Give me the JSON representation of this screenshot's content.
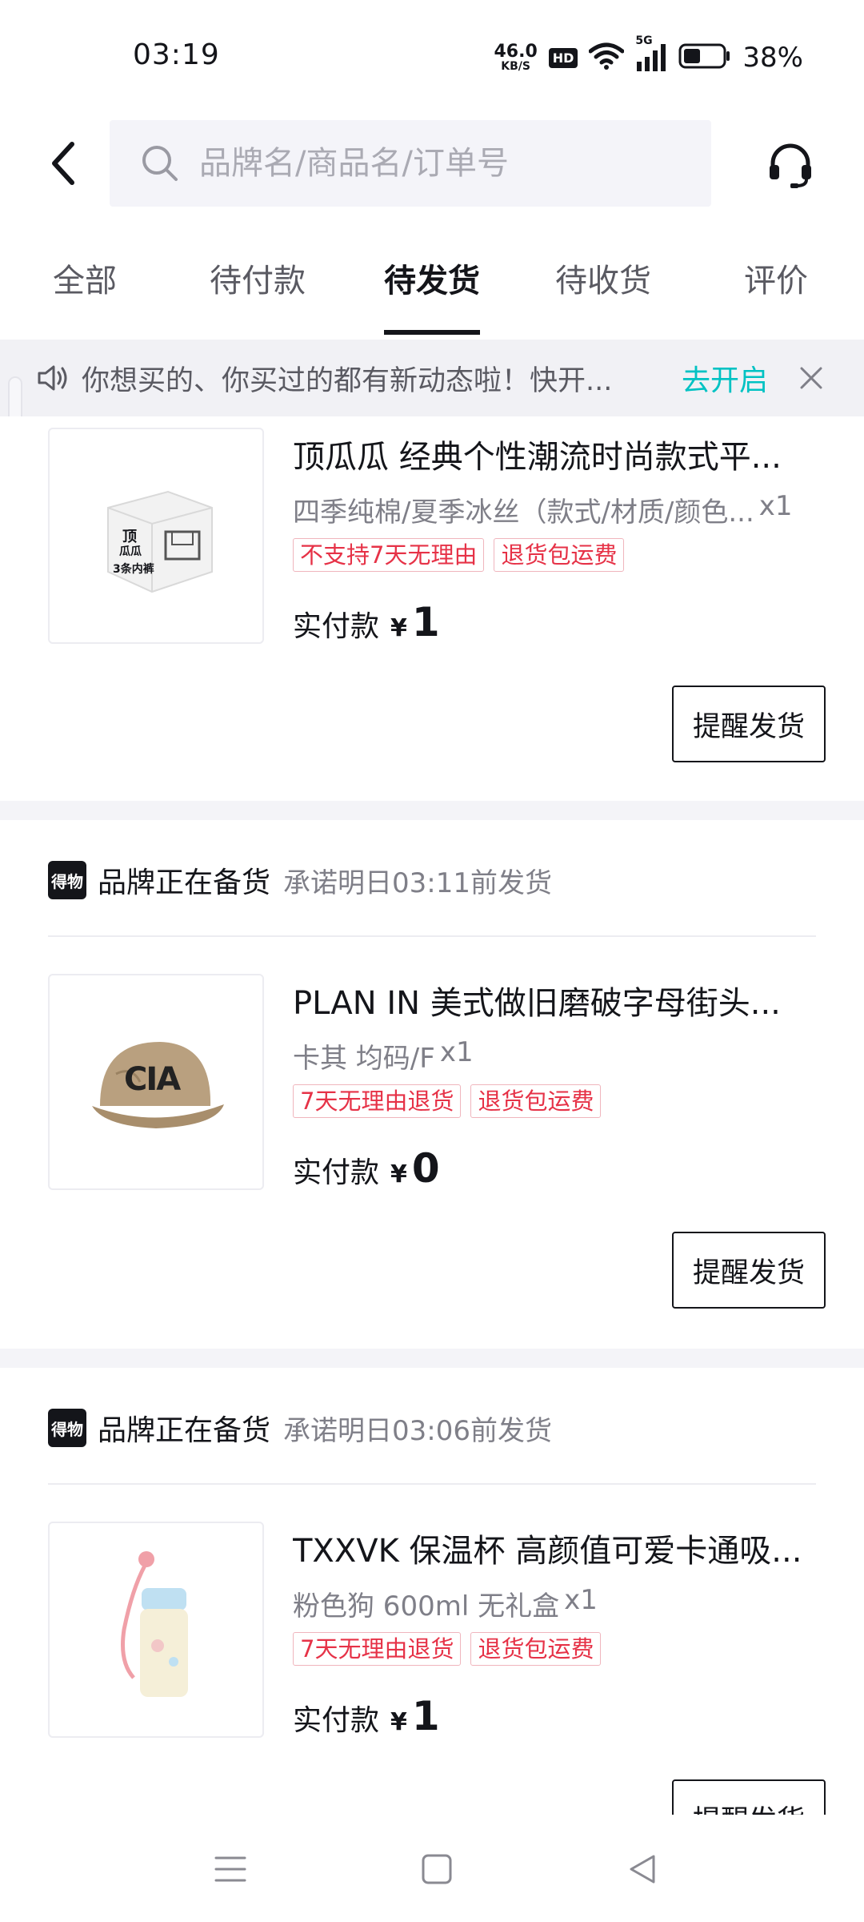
{
  "status_bar": {
    "time": "03:19",
    "net_speed_value": "46.0",
    "net_speed_unit": "KB/S",
    "hd": "HD",
    "signal_type": "5G",
    "battery": "38%"
  },
  "header": {
    "search_placeholder": "品牌名/商品名/订单号"
  },
  "tabs": [
    {
      "label": "全部"
    },
    {
      "label": "待付款"
    },
    {
      "label": "待发货"
    },
    {
      "label": "待收货"
    },
    {
      "label": "评价"
    }
  ],
  "active_tab": "待发货",
  "notice": {
    "text": "你想买的、你买过的都有新动态啦！快开...",
    "action": "去开启"
  },
  "orders": [
    {
      "title": "顶瓜瓜 经典个性潮流时尚款式平...",
      "spec": "四季纯棉/夏季冰丝（款式/材质/颜色...",
      "qty": "x1",
      "tags": [
        "不支持7天无理由",
        "退货包运费"
      ],
      "pay_label": "实付款",
      "currency": "¥",
      "amount": "1",
      "button": "提醒发货",
      "thumb_text": [
        "顶",
        "瓜瓜",
        "3条内裤"
      ]
    },
    {
      "brand_logo": "得物",
      "status": "品牌正在备货",
      "promise": "承诺明日03:11前发货",
      "title": "PLAN IN 美式做旧磨破字母街头...",
      "spec": "卡其 均码/F",
      "qty": "x1",
      "tags": [
        "7天无理由退货",
        "退货包运费"
      ],
      "pay_label": "实付款",
      "currency": "¥",
      "amount": "0",
      "button": "提醒发货",
      "thumb_text": "CIA"
    },
    {
      "brand_logo": "得物",
      "status": "品牌正在备货",
      "promise": "承诺明日03:06前发货",
      "title": "TXXVK 保温杯 高颜值可爱卡通吸...",
      "spec": "粉色狗 600ml 无礼盒",
      "qty": "x1",
      "tags": [
        "7天无理由退货",
        "退货包运费"
      ],
      "pay_label": "实付款",
      "currency": "¥",
      "amount": "1",
      "button": "提醒发货"
    }
  ],
  "colors": {
    "accent": "#01c2c3",
    "tag_red": "#e63247",
    "text_primary": "#14151a",
    "text_secondary": "#7f7f88"
  }
}
